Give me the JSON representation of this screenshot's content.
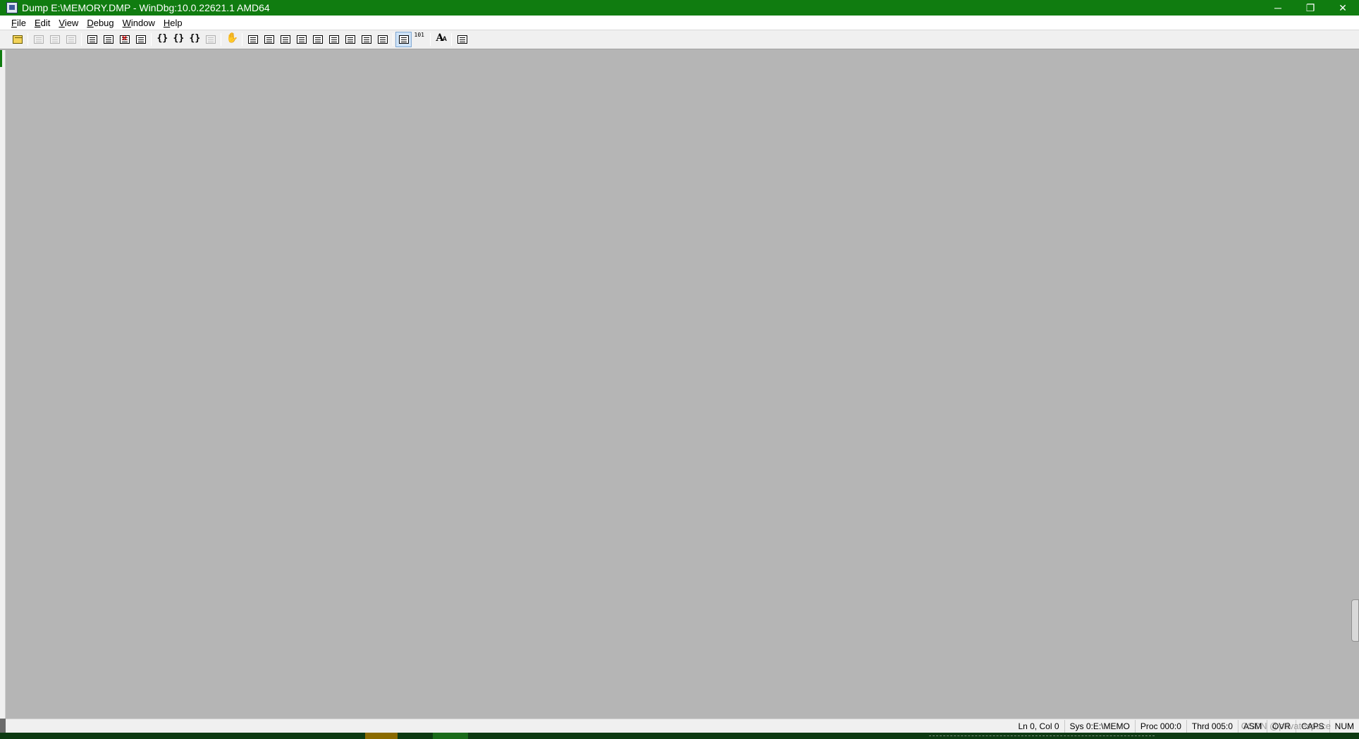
{
  "window": {
    "title": "Dump E:\\MEMORY.DMP - WinDbg:10.0.22621.1 AMD64",
    "minimize_glyph": "─",
    "restore_glyph": "❐",
    "close_glyph": "✕"
  },
  "menu": {
    "items": [
      "File",
      "Edit",
      "View",
      "Debug",
      "Window",
      "Help"
    ]
  },
  "toolbar": {
    "buttons": [
      {
        "icon": "open-folder-icon",
        "enabled": true
      },
      {
        "icon": "cut-icon",
        "enabled": false
      },
      {
        "icon": "copy-icon",
        "enabled": false
      },
      {
        "icon": "paste-icon",
        "enabled": false
      },
      {
        "icon": "go-icon",
        "enabled": true
      },
      {
        "icon": "restart-icon",
        "enabled": true
      },
      {
        "icon": "stop-debugging-icon",
        "enabled": true
      },
      {
        "icon": "break-icon",
        "enabled": true
      },
      {
        "icon": "step-into-icon",
        "enabled": true
      },
      {
        "icon": "step-over-icon",
        "enabled": true
      },
      {
        "icon": "step-out-icon",
        "enabled": true
      },
      {
        "icon": "run-to-cursor-icon",
        "enabled": false
      },
      {
        "icon": "insert-breakpoint-hand-icon",
        "enabled": true
      },
      {
        "icon": "command-window-icon",
        "enabled": true
      },
      {
        "icon": "watch-window-icon",
        "enabled": true
      },
      {
        "icon": "locals-window-icon",
        "enabled": true
      },
      {
        "icon": "registers-window-icon",
        "enabled": true
      },
      {
        "icon": "memory-window-icon",
        "enabled": true
      },
      {
        "icon": "call-stack-window-icon",
        "enabled": true
      },
      {
        "icon": "disassembly-window-icon",
        "enabled": true
      },
      {
        "icon": "scratch-pad-icon",
        "enabled": true
      },
      {
        "icon": "processes-threads-icon",
        "enabled": true
      },
      {
        "icon": "source-mode-icon",
        "enabled": true,
        "active": true
      },
      {
        "icon": "binary-mode-icon",
        "enabled": true
      },
      {
        "icon": "font-icon",
        "enabled": true
      },
      {
        "icon": "options-icon",
        "enabled": true
      }
    ]
  },
  "status": {
    "line_col": "Ln 0, Col 0",
    "sys": "Sys 0:E:\\MEMO",
    "proc": "Proc 000:0",
    "thrd": "Thrd 005:0",
    "asm": "ASM",
    "ovr": "OVR",
    "caps": "CAPS",
    "num": "NUM",
    "watermark": "CSDN @privatespace"
  }
}
